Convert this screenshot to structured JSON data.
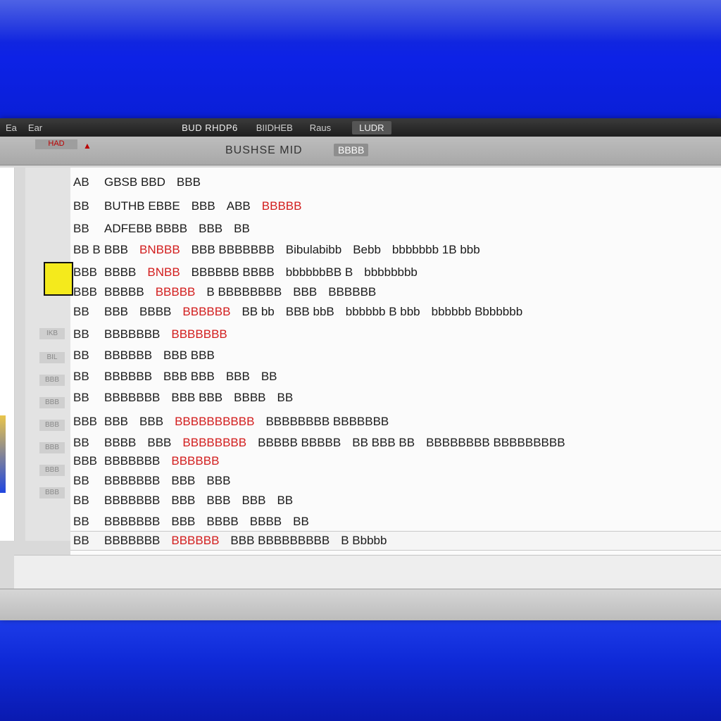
{
  "window": {
    "sys_left": "Ea",
    "sys_label": "Ear",
    "title": "BUD RHDP6",
    "subtitle": "BIIDHEB",
    "state": "Raus",
    "menu": "LUDR"
  },
  "toolbar": {
    "left_label": "HAD",
    "icon": "▲",
    "title": "BUSHSE MID",
    "badge": "BBBB"
  },
  "gutter": [
    "IKB",
    "BIL",
    "BBB",
    "BBB",
    "BBB",
    "BBB",
    "BBB",
    "BBB"
  ],
  "rows": [
    {
      "code": "AB",
      "segments": [
        {
          "text": "GBSB BBD",
          "red": false
        },
        {
          "text": "BBB",
          "red": false
        }
      ]
    },
    {
      "code": "BB",
      "segments": [
        {
          "text": "BUTHB EBBE",
          "red": false
        },
        {
          "text": "BBB",
          "red": false
        },
        {
          "text": "ABB",
          "red": false
        },
        {
          "text": "BBBBB",
          "red": true
        }
      ]
    },
    {
      "code": "BB",
      "segments": [
        {
          "text": "ADFEBB BBBB",
          "red": false
        },
        {
          "text": "BBB",
          "red": false
        },
        {
          "text": "BB",
          "red": false
        }
      ]
    },
    {
      "code": "BB B",
      "segments": [
        {
          "text": "BBB",
          "red": false
        },
        {
          "text": "BNBBB",
          "red": true
        },
        {
          "text": "BBB BBBBBBB",
          "red": false
        },
        {
          "text": "Bibulabibb",
          "red": false
        },
        {
          "text": "Bebb",
          "red": false
        },
        {
          "text": "bbbbbbb 1B bbb",
          "red": false
        }
      ]
    },
    {
      "code": "BBB",
      "segments": [
        {
          "text": "BBBB",
          "red": false
        },
        {
          "text": "BNBB",
          "red": true
        },
        {
          "text": "BBBBBB BBBB",
          "red": false
        },
        {
          "text": "bbbbbbBB B",
          "red": false
        },
        {
          "text": "bbbbbbbb",
          "red": false
        }
      ]
    },
    {
      "code": "BBB",
      "segments": [
        {
          "text": "BBBBB",
          "red": false
        },
        {
          "text": "BBBBB",
          "red": true
        },
        {
          "text": "B BBBBBBBB",
          "red": false
        },
        {
          "text": "BBB",
          "red": false
        },
        {
          "text": "BBBBBB",
          "red": false
        }
      ]
    },
    {
      "code": "BB",
      "segments": [
        {
          "text": "BBB",
          "red": false
        },
        {
          "text": "BBBB",
          "red": false
        },
        {
          "text": "BBBBBB",
          "red": true
        },
        {
          "text": "BB bb",
          "red": false
        },
        {
          "text": "BBB bbB",
          "red": false
        },
        {
          "text": "bbbbbb B bbb",
          "red": false
        },
        {
          "text": "bbbbbb Bbbbbbb",
          "red": false
        }
      ]
    },
    {
      "code": "BB",
      "segments": [
        {
          "text": "BBBBBBB",
          "red": false
        },
        {
          "text": "BBBBBBB",
          "red": true
        }
      ]
    },
    {
      "code": "BB",
      "segments": [
        {
          "text": "BBBBBB",
          "red": false
        },
        {
          "text": "BBB BBB",
          "red": false
        }
      ]
    },
    {
      "code": "BB",
      "segments": [
        {
          "text": "BBBBBB",
          "red": false
        },
        {
          "text": "BBB BBB",
          "red": false
        },
        {
          "text": "BBB",
          "red": false
        },
        {
          "text": "BB",
          "red": false
        }
      ]
    },
    {
      "code": "BB",
      "segments": [
        {
          "text": "BBBBBBB",
          "red": false
        },
        {
          "text": "BBB BBB",
          "red": false
        },
        {
          "text": "BBBB",
          "red": false
        },
        {
          "text": "BB",
          "red": false
        }
      ]
    },
    {
      "code": "BBB",
      "segments": [
        {
          "text": "BBB",
          "red": false
        },
        {
          "text": "BBB",
          "red": false
        },
        {
          "text": "BBBBBBBBBB",
          "red": true
        },
        {
          "text": "BBBBBBBB BBBBBBB",
          "red": false
        }
      ]
    },
    {
      "code": "BB",
      "segments": [
        {
          "text": "BBBB",
          "red": false
        },
        {
          "text": "BBB",
          "red": false
        },
        {
          "text": "BBBBBBBB",
          "red": true
        },
        {
          "text": "BBBBB BBBBB",
          "red": false
        },
        {
          "text": "BB BBB BB",
          "red": false
        },
        {
          "text": "BBBBBBBB BBBBBBBBB",
          "red": false
        }
      ]
    },
    {
      "code": "BBB",
      "segments": [
        {
          "text": "BBBBBBB",
          "red": false
        },
        {
          "text": "BBBBBB",
          "red": true
        }
      ]
    },
    {
      "code": "BB",
      "segments": [
        {
          "text": "BBBBBBB",
          "red": false
        },
        {
          "text": "BBB",
          "red": false
        },
        {
          "text": "BBB",
          "red": false
        }
      ]
    },
    {
      "code": "BB",
      "segments": [
        {
          "text": "BBBBBBB",
          "red": false
        },
        {
          "text": "BBB",
          "red": false
        },
        {
          "text": "BBB",
          "red": false
        },
        {
          "text": "BBB",
          "red": false
        },
        {
          "text": "BB",
          "red": false
        }
      ]
    },
    {
      "code": "BB",
      "segments": [
        {
          "text": "BBBBBBB",
          "red": false
        },
        {
          "text": "BBB",
          "red": false
        },
        {
          "text": "BBBB",
          "red": false
        },
        {
          "text": "BBBB",
          "red": false
        },
        {
          "text": "BB",
          "red": false
        }
      ]
    },
    {
      "code": "BB",
      "segments": [
        {
          "text": "BBBBBBB",
          "red": false
        },
        {
          "text": "BBBBBB",
          "red": true
        },
        {
          "text": "BBB BBBBBBBBB",
          "red": false
        },
        {
          "text": "B Bbbbb",
          "red": false
        }
      ]
    }
  ]
}
